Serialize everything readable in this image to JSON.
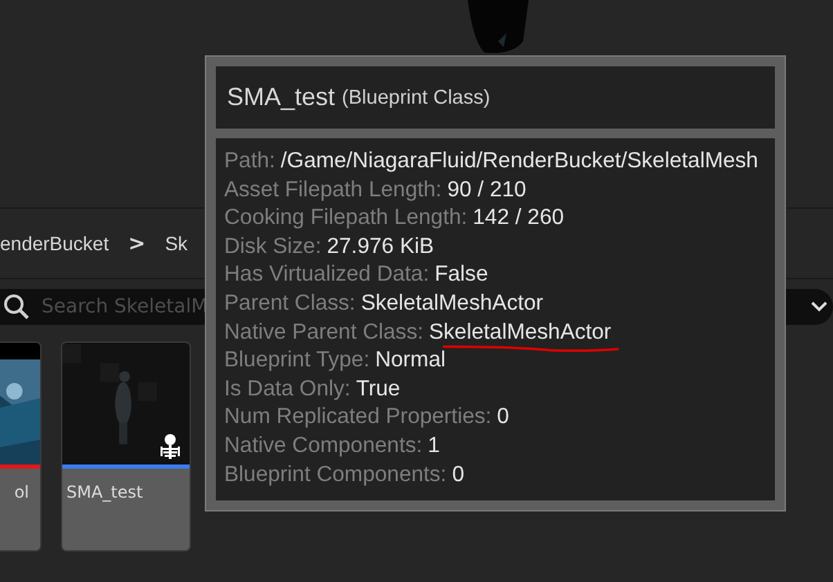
{
  "breadcrumb": {
    "items": [
      "enderBucket",
      "Sk"
    ],
    "separator": ">"
  },
  "search": {
    "placeholder": "Search SkeletalM"
  },
  "assets": [
    {
      "name": "ol",
      "kind": "level",
      "color": "#e01818"
    },
    {
      "name": "SMA_test",
      "kind": "skeletal",
      "color": "#3b7ded"
    }
  ],
  "tooltip": {
    "title": "SMA_test",
    "subtitle": "(Blueprint Class)",
    "properties": [
      {
        "label": "Path:",
        "value": "/Game/NiagaraFluid/RenderBucket/SkeletalMesh",
        "annotated": false
      },
      {
        "label": "Asset Filepath Length:",
        "value": "90 / 210",
        "annotated": false
      },
      {
        "label": "Cooking Filepath Length:",
        "value": "142 / 260",
        "annotated": false
      },
      {
        "label": "Disk Size:",
        "value": "27.976 KiB",
        "annotated": false
      },
      {
        "label": "Has Virtualized Data:",
        "value": "False",
        "annotated": false
      },
      {
        "label": "Parent Class:",
        "value": "SkeletalMeshActor",
        "annotated": false
      },
      {
        "label": "Native Parent Class:",
        "value": "SkeletalMeshActor",
        "annotated": true
      },
      {
        "label": "Blueprint Type:",
        "value": "Normal",
        "annotated": false
      },
      {
        "label": "Is Data Only:",
        "value": "True",
        "annotated": false
      },
      {
        "label": "Num Replicated Properties:",
        "value": "0",
        "annotated": false
      },
      {
        "label": "Native Components:",
        "value": "1",
        "annotated": false
      },
      {
        "label": "Blueprint Components:",
        "value": "0",
        "annotated": false
      }
    ]
  }
}
